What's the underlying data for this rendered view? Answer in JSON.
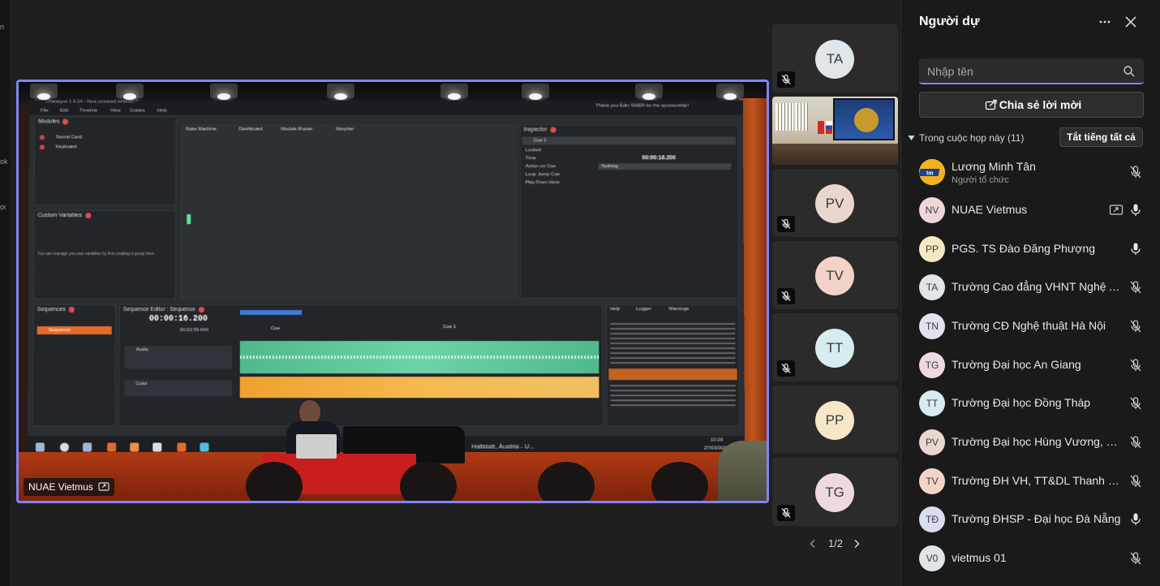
{
  "left_rail": {
    "labels": [
      "n",
      "ok",
      "ọi"
    ]
  },
  "main_video": {
    "caption": "NUAE Vietmus",
    "screen": {
      "title": "Chataigne 1.9.24 - New unsaved session *",
      "sponsor": "Thank you Edin SMER for the sponsorship!",
      "menu": [
        "File",
        "Edit",
        "Timeline",
        "View",
        "Guides",
        "Help"
      ],
      "modules_title": "Modules",
      "modules": [
        "Sound Card",
        "Keyboard"
      ],
      "tabs": [
        "State Machine",
        "Dashboard",
        "Module Router",
        "Morpher"
      ],
      "custom_vars_title": "Custom Variables",
      "custom_vars_hint": "You can manage you own variables by first creating a group here.",
      "inspector_title": "Inspector",
      "inspector_cue": "Cue 1",
      "inspector_fields": [
        "Locked",
        "Time",
        "Action on Cue",
        "Loop Jump Cue",
        "Play From Here"
      ],
      "inspector_time": "00:00:16.200",
      "inspector_action": "Nothing",
      "sequences_title": "Sequences",
      "sequence_item": "Sequence",
      "seq_editor_title": "Sequence Editor : Sequence",
      "timecode": "00:00:16.200",
      "timecode_total": "00:02:59.640",
      "cue_labels": [
        "Cue",
        "Cue 1"
      ],
      "layers": [
        "Audio",
        "Color"
      ],
      "log_tabs": [
        "Help",
        "Logger",
        "Warnings"
      ],
      "taskbar_location": "Hallstatt, Áustria - U...",
      "taskbar_time": "10:29",
      "taskbar_date": "27/03/2025"
    }
  },
  "tiles": [
    {
      "initials": "TA",
      "color": "#e0e6e9",
      "muted": true
    },
    {
      "type": "room",
      "muted": false
    },
    {
      "initials": "PV",
      "color": "#e9d6cf",
      "muted": true
    },
    {
      "initials": "TV",
      "color": "#f3d2c8",
      "muted": true
    },
    {
      "initials": "TT",
      "color": "#d7ecee",
      "muted": true
    },
    {
      "initials": "PP",
      "color": "#f7e7c6",
      "muted": true
    },
    {
      "initials": "TG",
      "color": "#eed8e2",
      "muted": true
    }
  ],
  "pager": {
    "label": "1/2"
  },
  "panel": {
    "title": "Người dự",
    "search_placeholder": "Nhập tên",
    "share_label": "Chia sẻ lời mời",
    "section_label": "Trong cuộc họp này (11)",
    "mute_all_label": "Tắt tiếng tất cả"
  },
  "people": [
    {
      "name": "Lương Minh Tân",
      "role": "Người tổ chức",
      "avatar": "logo",
      "mic": "muted"
    },
    {
      "name": "NUAE Vietmus",
      "initials": "NV",
      "color": "#efd7d9",
      "mic": "on",
      "sharing": true
    },
    {
      "name": "PGS. TS Đào Đăng Phượng",
      "initials": "PP",
      "color": "#f7e8c4",
      "mic": "on"
    },
    {
      "name": "Trường Cao đẳng VHNT Nghệ An",
      "initials": "TA",
      "color": "#dfe5e8",
      "mic": "muted"
    },
    {
      "name": "Trường CĐ Nghệ thuật Hà Nội",
      "initials": "TN",
      "color": "#e2e2ef",
      "mic": "muted"
    },
    {
      "name": "Trường Đại học An Giang",
      "initials": "TG",
      "color": "#eed8e3",
      "mic": "muted"
    },
    {
      "name": "Trường Đại học Đồng Tháp",
      "initials": "TT",
      "color": "#d8ecee",
      "mic": "muted"
    },
    {
      "name": "Trường Đại học Hùng Vương, Ph...",
      "initials": "PV",
      "color": "#ead6cf",
      "mic": "muted"
    },
    {
      "name": "Trường ĐH VH, TT&DL Thanh Hóa",
      "initials": "TV",
      "color": "#f4d3c9",
      "mic": "muted"
    },
    {
      "name": "Trường ĐHSP - Đại học Đà Nẵng",
      "initials": "TĐ",
      "color": "#dadcf0",
      "mic": "on"
    },
    {
      "name": "vietmus 01",
      "initials": "V0",
      "color": "#dfe4e7",
      "mic": "muted"
    }
  ]
}
